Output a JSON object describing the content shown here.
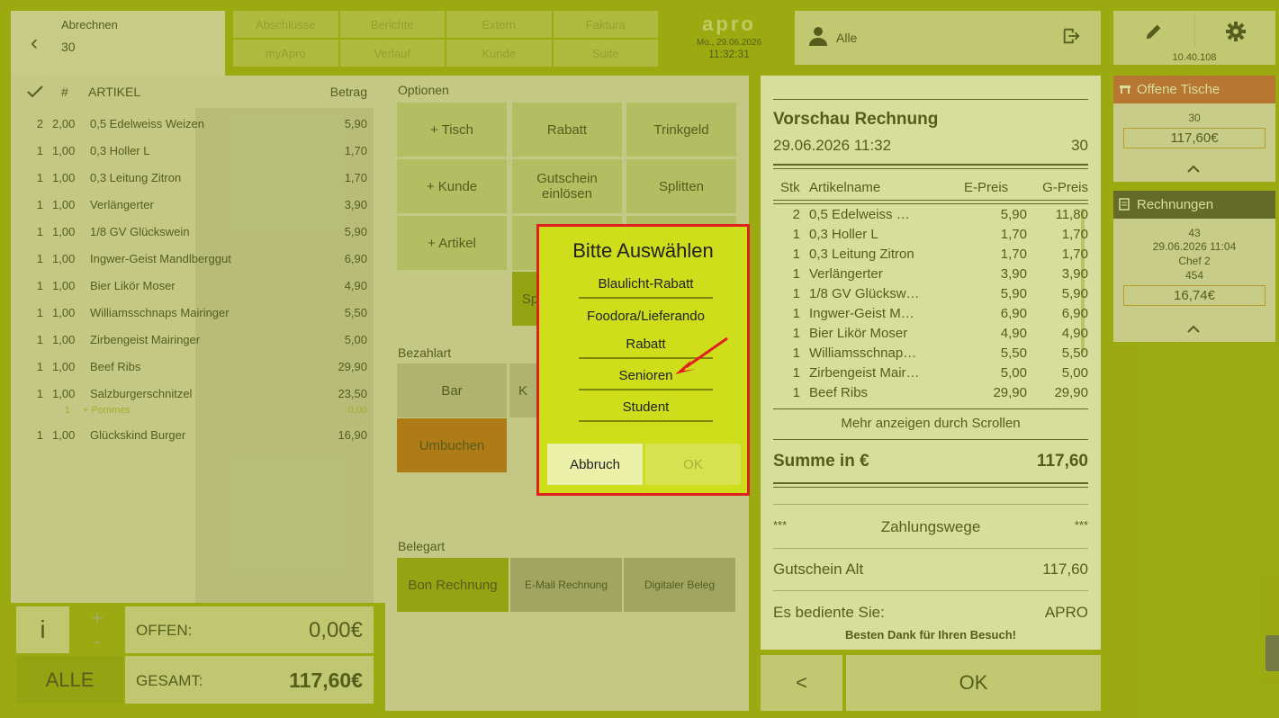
{
  "header": {
    "title": "Abrechnen",
    "table": "30"
  },
  "nav": [
    "Abschlüsse",
    "Berichte",
    "Extern",
    "Faktura",
    "myApro",
    "Verlauf",
    "Kunde",
    "Suite"
  ],
  "logo": {
    "text": "apro",
    "date": "Mo., 29.06.2026",
    "time": "11:32:31"
  },
  "user": {
    "label": "Alle"
  },
  "device": {
    "ip": "10.40.108"
  },
  "left": {
    "headers": {
      "num": "#",
      "article": "ARTIKEL",
      "amount": "Betrag"
    },
    "items": [
      {
        "q": "2",
        "n": "2,00",
        "name": "0,5 Edelweiss Weizen",
        "amount": "5,90"
      },
      {
        "q": "1",
        "n": "1,00",
        "name": "0,3 Holler L",
        "amount": "1,70"
      },
      {
        "q": "1",
        "n": "1,00",
        "name": "0,3 Leitung Zitron",
        "amount": "1,70"
      },
      {
        "q": "1",
        "n": "1,00",
        "name": "Verlängerter",
        "amount": "3,90"
      },
      {
        "q": "1",
        "n": "1,00",
        "name": "1/8 GV Glückswein",
        "amount": "5,90"
      },
      {
        "q": "1",
        "n": "1,00",
        "name": "Ingwer-Geist Mandlberggut",
        "amount": "6,90"
      },
      {
        "q": "1",
        "n": "1,00",
        "name": "Bier Likör Moser",
        "amount": "4,90"
      },
      {
        "q": "1",
        "n": "1,00",
        "name": "Williamsschnaps Mairinger",
        "amount": "5,50"
      },
      {
        "q": "1",
        "n": "1,00",
        "name": "Zirbengeist Mairinger",
        "amount": "5,00"
      },
      {
        "q": "1",
        "n": "1,00",
        "name": "Beef Ribs",
        "amount": "29,90"
      },
      {
        "q": "1",
        "n": "1,00",
        "name": "Salzburgerschnitzel",
        "amount": "23,50"
      }
    ],
    "sub": {
      "q": "1",
      "name": "+ Pommes",
      "amount": "0,00"
    },
    "last": {
      "q": "1",
      "n": "1,00",
      "name": "Glückskind Burger",
      "amount": "16,90"
    },
    "info": "i",
    "plus": "+",
    "minus": "-",
    "offen_label": "OFFEN:",
    "offen_value": "0,00€",
    "alle": "ALLE",
    "gesamt_label": "GESAMT:",
    "gesamt_value": "117,60€"
  },
  "options": {
    "title": "Optionen",
    "buttons": [
      "+ Tisch",
      "Rabatt",
      "Trinkgeld",
      "+ Kunde",
      "Gutschein einlösen",
      "Splitten",
      "+ Artikel"
    ],
    "partial": "Sp"
  },
  "payment": {
    "title": "Bezahlart",
    "bar": "Bar",
    "partial": "K",
    "umbuchen": "Umbuchen"
  },
  "belegart": {
    "title": "Belegart",
    "buttons": [
      "Bon Rechnung",
      "E-Mail Rechnung",
      "Digitaler Beleg"
    ]
  },
  "preview": {
    "title": "Vorschau Rechnung",
    "date": "29.06.2026 11:32",
    "table": "30",
    "headers": {
      "qty": "Stk",
      "name": "Artikelname",
      "ep": "E-Preis",
      "gp": "G-Preis"
    },
    "rows": [
      {
        "q": "2",
        "name": "0,5 Edelweiss …",
        "ep": "5,90",
        "gp": "11,80"
      },
      {
        "q": "1",
        "name": "0,3 Holler L",
        "ep": "1,70",
        "gp": "1,70"
      },
      {
        "q": "1",
        "name": "0,3 Leitung Zitron",
        "ep": "1,70",
        "gp": "1,70"
      },
      {
        "q": "1",
        "name": "Verlängerter",
        "ep": "3,90",
        "gp": "3,90"
      },
      {
        "q": "1",
        "name": "1/8 GV Glücksw…",
        "ep": "5,90",
        "gp": "5,90"
      },
      {
        "q": "1",
        "name": "Ingwer-Geist M…",
        "ep": "6,90",
        "gp": "6,90"
      },
      {
        "q": "1",
        "name": "Bier Likör Moser",
        "ep": "4,90",
        "gp": "4,90"
      },
      {
        "q": "1",
        "name": "Williamsschnap…",
        "ep": "5,50",
        "gp": "5,50"
      },
      {
        "q": "1",
        "name": "Zirbengeist Mair…",
        "ep": "5,00",
        "gp": "5,00"
      },
      {
        "q": "1",
        "name": "Beef Ribs",
        "ep": "29,90",
        "gp": "29,90"
      }
    ],
    "more": "Mehr anzeigen durch Scrollen",
    "sum_label": "Summe in €",
    "sum_value": "117,60",
    "stars": "***",
    "zahlungswege": "Zahlungswege",
    "gutschein_label": "Gutschein Alt",
    "gutschein_value": "117,60",
    "served_label": "Es bediente Sie:",
    "served_value": "APRO",
    "thanks": "Besten Dank für Ihren Besuch!"
  },
  "bottom": {
    "back": "<",
    "ok": "OK"
  },
  "offene": {
    "title": "Offene Tische",
    "table": "30",
    "amount": "117,60€"
  },
  "rechnungen": {
    "title": "Rechnungen",
    "id": "43",
    "date": "29.06.2026 11:04",
    "user": "Chef 2",
    "num": "454",
    "amount": "16,74€"
  },
  "dialog": {
    "title": "Bitte Auswählen",
    "options": [
      "Blaulicht-Rabatt",
      "Foodora/Lieferando",
      "Rabatt",
      "Senioren",
      "Student"
    ],
    "cancel": "Abbruch",
    "ok": "OK"
  }
}
